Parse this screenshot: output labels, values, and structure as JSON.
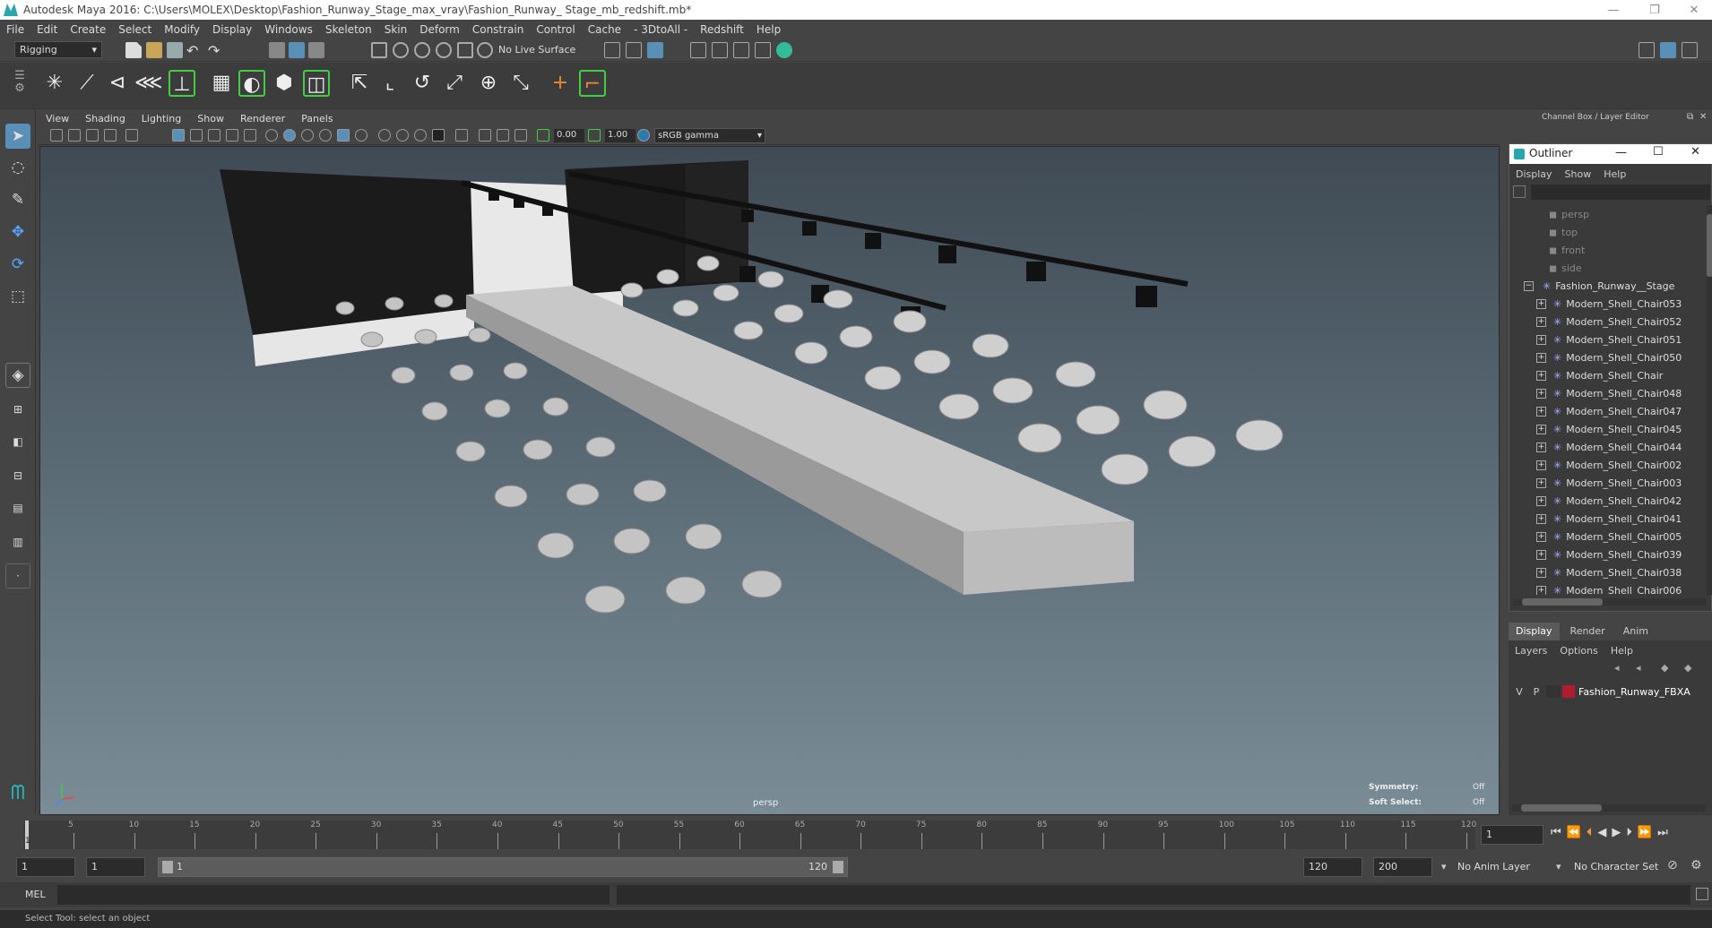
{
  "window": {
    "title": "Autodesk Maya 2016: C:\\Users\\MOLEX\\Desktop\\Fashion_Runway_Stage_max_vray\\Fashion_Runway_ Stage_mb_redshift.mb*"
  },
  "menu": [
    "File",
    "Edit",
    "Create",
    "Select",
    "Modify",
    "Display",
    "Windows",
    "Skeleton",
    "Skin",
    "Deform",
    "Constrain",
    "Control",
    "Cache",
    "- 3DtoAll -",
    "Redshift",
    "Help"
  ],
  "status": {
    "menu_set": "Rigging",
    "live_surface": "No Live Surface"
  },
  "panel_menu": [
    "View",
    "Shading",
    "Lighting",
    "Show",
    "Renderer",
    "Panels"
  ],
  "panel_toolbar": {
    "near": "0.00",
    "far": "1.00",
    "color_space": "sRGB gamma"
  },
  "viewport": {
    "camera_label": "persp",
    "symmetry_label": "Symmetry:",
    "symmetry_value": "Off",
    "soft_select_label": "Soft Select:",
    "soft_select_value": "Off"
  },
  "channel_box_title": "Channel Box / Layer Editor",
  "outliner": {
    "title": "Outliner",
    "menu": [
      "Display",
      "Show",
      "Help"
    ],
    "cameras": [
      "persp",
      "top",
      "front",
      "side"
    ],
    "root": "Fashion_Runway__Stage",
    "items": [
      "Modern_Shell_Chair053",
      "Modern_Shell_Chair052",
      "Modern_Shell_Chair051",
      "Modern_Shell_Chair050",
      "Modern_Shell_Chair",
      "Modern_Shell_Chair048",
      "Modern_Shell_Chair047",
      "Modern_Shell_Chair045",
      "Modern_Shell_Chair044",
      "Modern_Shell_Chair002",
      "Modern_Shell_Chair003",
      "Modern_Shell_Chair042",
      "Modern_Shell_Chair041",
      "Modern_Shell_Chair005",
      "Modern_Shell_Chair039",
      "Modern_Shell_Chair038",
      "Modern_Shell_Chair006"
    ]
  },
  "layer_editor": {
    "tabs": [
      "Display",
      "Render",
      "Anim"
    ],
    "menu": [
      "Layers",
      "Options",
      "Help"
    ],
    "layer": {
      "v": "V",
      "p": "P",
      "name": "Fashion_Runway_FBXA",
      "color": "#b01c2e"
    }
  },
  "timeline": {
    "ticks": [
      "5",
      "10",
      "15",
      "20",
      "25",
      "30",
      "35",
      "40",
      "45",
      "50",
      "55",
      "60",
      "65",
      "70",
      "75",
      "80",
      "85",
      "90",
      "95",
      "100",
      "105",
      "110",
      "115",
      "120"
    ],
    "current_frame": "1",
    "start_tick": "1"
  },
  "range": {
    "start": "1",
    "start2": "1",
    "slider_start": "1",
    "slider_end": "120",
    "end": "120",
    "end2": "200",
    "anim_layer": "No Anim Layer",
    "char_set": "No Character Set"
  },
  "mel": {
    "label": "MEL"
  },
  "help_line": "Select Tool: select an object"
}
